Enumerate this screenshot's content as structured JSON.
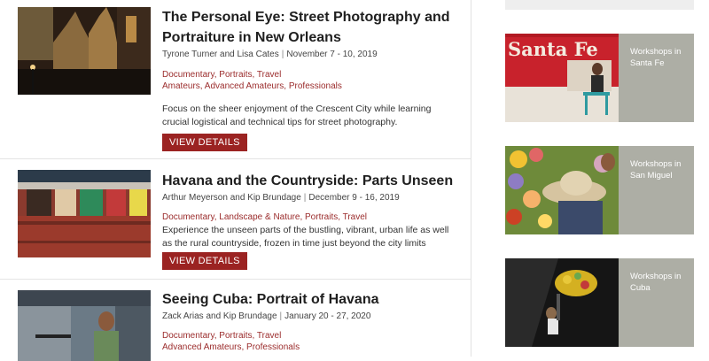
{
  "workshops": [
    {
      "title": "The Personal Eye: Street Photography and Portraiture in New Orleans",
      "instructors": "Tyrone Turner and Lisa Cates",
      "dates": "November 7 - 10, 2019",
      "tags_line1": "Documentary, Portraits, Travel",
      "tags_line2": "Amateurs, Advanced Amateurs, Professionals",
      "description": "Focus on the sheer enjoyment of the Crescent City while learning crucial logistical and technical tips for street photography.",
      "button": "View Details"
    },
    {
      "title": "Havana and the Countryside: Parts Unseen",
      "instructors": "Arthur Meyerson and Kip Brundage",
      "dates": "December 9 - 16, 2019",
      "tags_line1": "Documentary, Landscape & Nature, Portraits, Travel",
      "description": "Experience the unseen parts of the bustling, vibrant, urban life as well as the rural countryside, frozen in time just beyond the city limits",
      "button": "View Details"
    },
    {
      "title": "Seeing Cuba: Portrait of Havana",
      "instructors": "Zack Arias and Kip Brundage",
      "dates": "January 20 - 27, 2020",
      "tags_line1": "Documentary, Portraits, Travel",
      "tags_line2": "Advanced Amateurs, Professionals"
    }
  ],
  "sidebar": [
    {
      "label_line1": "Workshops in",
      "label_line2": "Santa Fe",
      "sign_text": "Santa Fe"
    },
    {
      "label_line1": "Workshops in",
      "label_line2": "San Miguel"
    },
    {
      "label_line1": "Workshops in",
      "label_line2": "Cuba"
    }
  ],
  "colors": {
    "accent": "#9b2322",
    "tag": "#9b2c2c",
    "sidebar_bg": "#adaea5"
  }
}
